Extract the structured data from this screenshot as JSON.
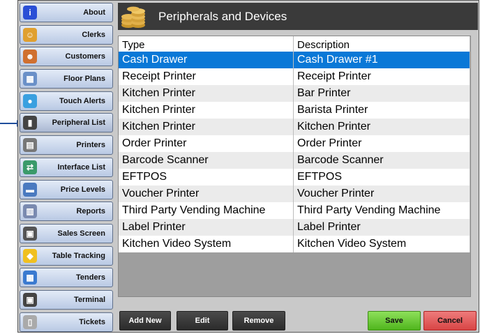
{
  "sidebar": {
    "items": [
      {
        "label": "About",
        "icon": "info-icon",
        "color": "#2a4fd6"
      },
      {
        "label": "Clerks",
        "icon": "clerks-icon",
        "color": "#e0a030"
      },
      {
        "label": "Customers",
        "icon": "customers-icon",
        "color": "#d07030"
      },
      {
        "label": "Floor Plans",
        "icon": "floor-plans-icon",
        "color": "#6a90c8"
      },
      {
        "label": "Touch Alerts",
        "icon": "touch-alerts-icon",
        "color": "#3aa0e0"
      },
      {
        "label": "Peripheral List",
        "icon": "barcode-scanner-icon",
        "color": "#444444"
      },
      {
        "label": "Printers",
        "icon": "printer-icon",
        "color": "#777777"
      },
      {
        "label": "Interface List",
        "icon": "interface-icon",
        "color": "#3a9a6a"
      },
      {
        "label": "Price Levels",
        "icon": "price-levels-icon",
        "color": "#4a7ac0"
      },
      {
        "label": "Reports",
        "icon": "reports-icon",
        "color": "#7a8ab0"
      },
      {
        "label": "Sales Screen",
        "icon": "sales-screen-icon",
        "color": "#555555"
      },
      {
        "label": "Table Tracking",
        "icon": "table-tracking-icon",
        "color": "#f0c020"
      },
      {
        "label": "Tenders",
        "icon": "tenders-icon",
        "color": "#3a7ad0"
      },
      {
        "label": "Terminal",
        "icon": "terminal-icon",
        "color": "#444444"
      },
      {
        "label": "Tickets",
        "icon": "tickets-icon",
        "color": "#aaaaaa"
      }
    ]
  },
  "header": {
    "title": "Peripherals and Devices",
    "icon": "coins-icon"
  },
  "table": {
    "columns": [
      "Type",
      "Description"
    ],
    "rows": [
      [
        "Cash Drawer",
        "Cash Drawer #1"
      ],
      [
        "Receipt Printer",
        "Receipt Printer"
      ],
      [
        "Kitchen Printer",
        "Bar Printer"
      ],
      [
        "Kitchen Printer",
        "Barista Printer"
      ],
      [
        "Kitchen Printer",
        "Kitchen Printer"
      ],
      [
        "Order Printer",
        "Order Printer"
      ],
      [
        "Barcode Scanner",
        "Barcode Scanner"
      ],
      [
        "EFTPOS",
        "EFTPOS"
      ],
      [
        "Voucher Printer",
        "Voucher Printer"
      ],
      [
        "Third Party Vending Machine",
        "Third Party Vending Machine"
      ],
      [
        "Label Printer",
        "Label Printer"
      ],
      [
        "Kitchen Video System",
        "Kitchen Video System"
      ]
    ],
    "selected_row": 0,
    "selected_color": "#0a78d7"
  },
  "actions": {
    "add_new": "Add New",
    "edit": "Edit",
    "remove": "Remove",
    "save": "Save",
    "cancel": "Cancel"
  }
}
